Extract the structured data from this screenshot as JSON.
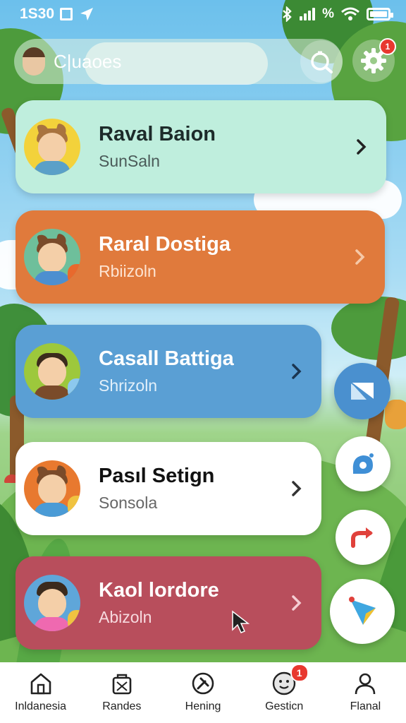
{
  "status_bar": {
    "time": "1S30",
    "percent_label": "%"
  },
  "header": {
    "search_label": "C|uaoes",
    "notification_count": "1"
  },
  "cards": [
    {
      "name": "Raval Baion",
      "subtitle": "SunSaln",
      "color": "#bfeedd"
    },
    {
      "name": "Raral Dostiga",
      "subtitle": "Rbiizoln",
      "color": "#e07a3c"
    },
    {
      "name": "Casall Battiga",
      "subtitle": "Shrizoln",
      "color": "#5a9fd4"
    },
    {
      "name": "Pasıl Setign",
      "subtitle": "Sonsola",
      "color": "#ffffff"
    },
    {
      "name": "Kaol lordore",
      "subtitle": "Abizoln",
      "color": "#b84e5c"
    }
  ],
  "fabs": [
    "paper-plane-icon",
    "chat-icon",
    "redo-icon",
    "send-icon"
  ],
  "bottom_nav": {
    "items": [
      {
        "label": "Inldanesia",
        "icon": "home-icon"
      },
      {
        "label": "Randes",
        "icon": "bag-icon"
      },
      {
        "label": "Hening",
        "icon": "compass-icon"
      },
      {
        "label": "Gesticn",
        "icon": "face-icon",
        "badge": "1"
      },
      {
        "label": "Flanal",
        "icon": "profile-icon"
      }
    ]
  }
}
